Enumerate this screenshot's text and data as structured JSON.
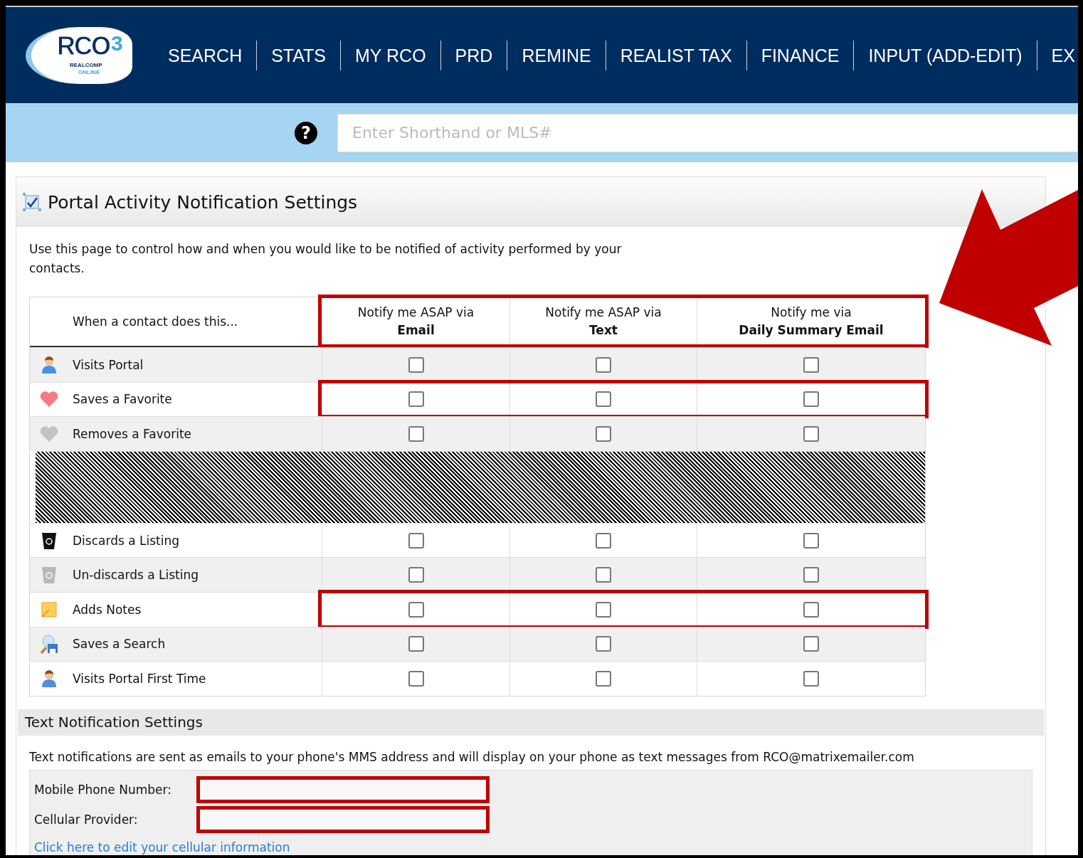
{
  "logo": {
    "text": "RCO",
    "superscript": "3",
    "line1": "REALCOMP",
    "line2": "ONLINE"
  },
  "nav": [
    {
      "label": "SEARCH"
    },
    {
      "label": "STATS"
    },
    {
      "label": "MY RCO"
    },
    {
      "label": "PRD"
    },
    {
      "label": "REMINE"
    },
    {
      "label": "REALIST TAX"
    },
    {
      "label": "FINANCE"
    },
    {
      "label": "INPUT (ADD-EDIT)"
    },
    {
      "label": "EX"
    }
  ],
  "search": {
    "help": "?",
    "placeholder": "Enter Shorthand or MLS#"
  },
  "panel": {
    "title": "Portal Activity Notification Settings",
    "description": "Use this page to control how and when you would like to be notified of activity performed by your contacts."
  },
  "table": {
    "header": {
      "label": "When a contact does this...",
      "highlighted": true
    },
    "columns": [
      {
        "line1": "Notify me ASAP via",
        "line2": "Email"
      },
      {
        "line1": "Notify me ASAP via",
        "line2": "Text"
      },
      {
        "line1": "Notify me via",
        "line2": "Daily Summary Email"
      }
    ],
    "rows": [
      {
        "kind": "person",
        "label": "Visits Portal",
        "highlighted": false,
        "checks": [
          false,
          false,
          false
        ]
      },
      {
        "kind": "heart",
        "label": "Saves a Favorite",
        "highlighted": true,
        "checks": [
          false,
          false,
          false
        ]
      },
      {
        "kind": "heart-faded",
        "label": "Removes a Favorite",
        "highlighted": false,
        "checks": [
          false,
          false,
          false
        ]
      },
      {
        "kind": "redacted"
      },
      {
        "kind": "trash",
        "label": "Discards a Listing",
        "highlighted": false,
        "checks": [
          false,
          false,
          false
        ]
      },
      {
        "kind": "trash-faded",
        "label": "Un-discards a Listing",
        "highlighted": false,
        "checks": [
          false,
          false,
          false
        ]
      },
      {
        "kind": "note",
        "label": "Adds Notes",
        "highlighted": true,
        "checks": [
          false,
          false,
          false
        ]
      },
      {
        "kind": "search-save",
        "label": "Saves a Search",
        "highlighted": false,
        "checks": [
          false,
          false,
          false
        ]
      },
      {
        "kind": "person",
        "label": "Visits Portal First Time",
        "highlighted": false,
        "checks": [
          false,
          false,
          false
        ]
      }
    ]
  },
  "text_settings": {
    "title": "Text Notification Settings",
    "note": "Text notifications are sent as emails to your phone's MMS address and will display on your phone as text messages from RCO@matrixemailer.com",
    "fields": [
      {
        "label": "Mobile Phone Number:",
        "highlighted": true
      },
      {
        "label": "Cellular Provider:",
        "highlighted": true
      }
    ],
    "link": "Click here to edit your cellular information"
  }
}
